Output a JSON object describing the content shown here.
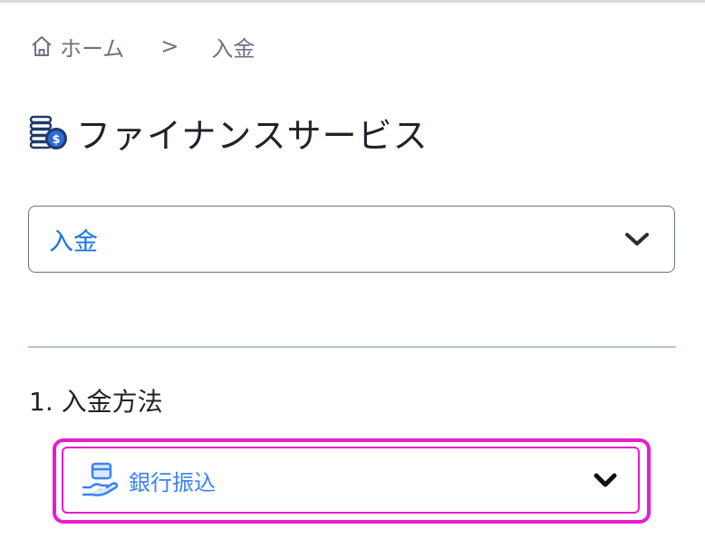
{
  "breadcrumb": {
    "home_label": "ホーム",
    "separator": ">",
    "current_label": "入金"
  },
  "page": {
    "title": "ファイナンスサービス",
    "title_icon": "coins-dollar-icon"
  },
  "main_select": {
    "value": "入金"
  },
  "section": {
    "title": "1. 入金方法"
  },
  "method_select": {
    "value": "銀行振込",
    "icon": "bank-transfer-card-hand-icon"
  },
  "colors": {
    "accent_blue": "#1a73e8",
    "method_blue": "#3b82f6",
    "highlight_magenta": "#e81ccf",
    "text_dark": "#1f2329",
    "muted": "#6b7280"
  }
}
